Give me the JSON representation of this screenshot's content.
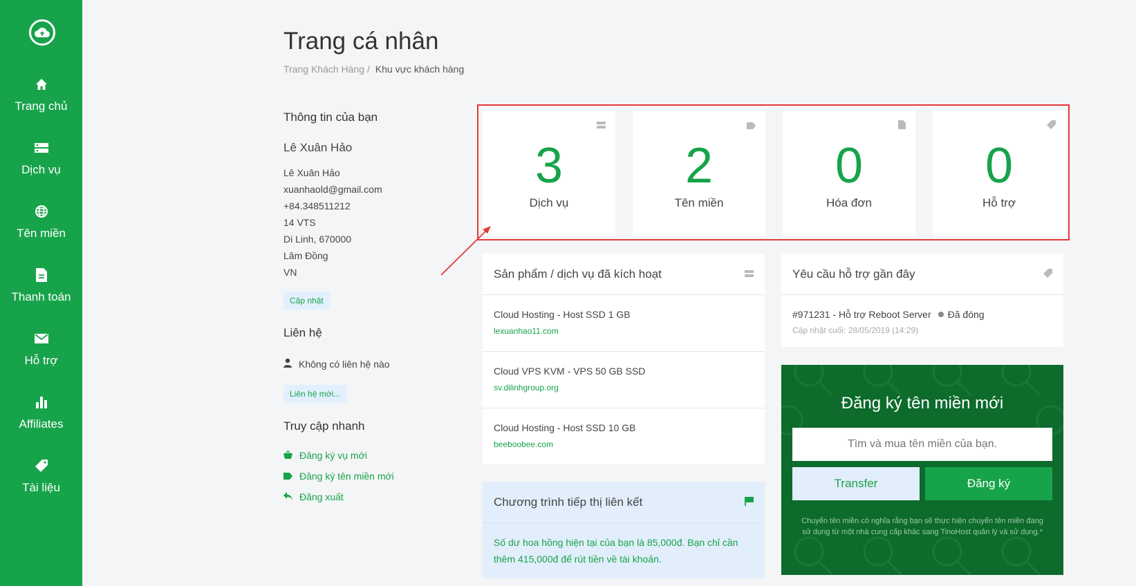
{
  "sidebar": {
    "items": [
      {
        "label": "Trang chủ",
        "icon": "home-icon"
      },
      {
        "label": "Dịch vụ",
        "icon": "server-icon"
      },
      {
        "label": "Tên miền",
        "icon": "globe-icon"
      },
      {
        "label": "Thanh toán",
        "icon": "document-icon"
      },
      {
        "label": "Hỗ trợ",
        "icon": "envelope-icon"
      },
      {
        "label": "Affiliates",
        "icon": "bar-chart-icon"
      },
      {
        "label": "Tài liệu",
        "icon": "tag-icon"
      }
    ]
  },
  "header": {
    "title": "Trang cá nhân",
    "breadcrumb": {
      "parent": "Trang Khách Hàng",
      "separator": "/",
      "current": "Khu vực khách hàng"
    }
  },
  "profile": {
    "section_title": "Thông tin của bạn",
    "name": "Lê Xuân Hảo",
    "lines": [
      "Lê Xuân Hảo",
      "xuanhaold@gmail.com",
      "+84.348511212",
      "14 VTS",
      "Di Linh, 670000",
      "Lâm Đồng",
      "VN"
    ],
    "update_label": "Cập nhật"
  },
  "contacts": {
    "section_title": "Liên hệ",
    "empty_text": "Không có liên hệ nào",
    "new_label": "Liên hệ mới..."
  },
  "quick_access": {
    "section_title": "Truy cập nhanh",
    "links": [
      "Đăng ký vụ mới",
      "Đăng ký tên miền mới",
      "Đăng xuất"
    ]
  },
  "stats": [
    {
      "value": "3",
      "label": "Dịch vụ"
    },
    {
      "value": "2",
      "label": "Tên miền"
    },
    {
      "value": "0",
      "label": "Hóa đơn"
    },
    {
      "value": "0",
      "label": "Hỗ trợ"
    }
  ],
  "services_panel": {
    "title": "Sản phẩm / dịch vụ đã kích hoạt",
    "items": [
      {
        "name": "Cloud Hosting - Host SSD 1 GB",
        "domain": "lexuanhao11.com"
      },
      {
        "name": "Cloud VPS KVM - VPS 50 GB SSD",
        "domain": "sv.dilinhgroup.org"
      },
      {
        "name": "Cloud Hosting - Host SSD 10 GB",
        "domain": "beeboobee.com"
      }
    ]
  },
  "affiliate_panel": {
    "title": "Chương trình tiếp thị liên kết",
    "text": "Số dư hoa hồng hiện tại của bạn là 85,000đ. Bạn chỉ cần thêm 415,000đ để rút tiền về tài khoản."
  },
  "tickets_panel": {
    "title": "Yêu cầu hỗ trợ gần đây",
    "ticket_title": "#971231 - Hỗ trợ Reboot Server",
    "ticket_status": "Đã đóng",
    "ticket_updated": "Cập nhật cuối: 28/05/2019 (14:29)"
  },
  "domain_search": {
    "title": "Đăng ký tên miền mới",
    "placeholder": "Tìm và mua tên miền của bạn.",
    "transfer_label": "Transfer",
    "register_label": "Đăng ký",
    "note": "Chuyển tên miền có nghĩa rằng bạn sẽ thực hiện chuyển tên miền đang sử dụng từ một nhà cung cấp khác sang TinoHost quản lý và sử dụng.*"
  },
  "colors": {
    "brand": "#17a34a",
    "brand_dark": "#0d6b2c",
    "highlight": "#e53935"
  }
}
